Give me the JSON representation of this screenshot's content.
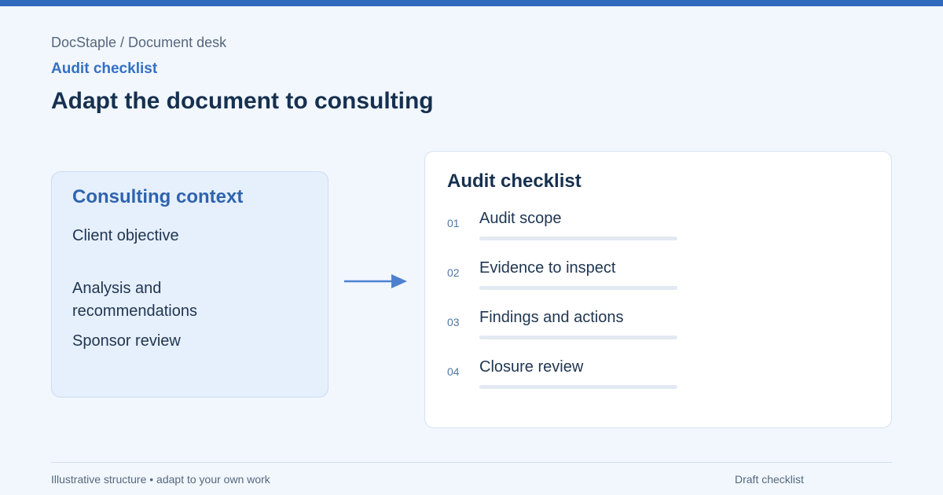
{
  "colors": {
    "accent": "#2f6abd",
    "kicker": "#3370c4",
    "background": "#f2f7fe",
    "context_card": "#e6effc",
    "text": "#16304f"
  },
  "header": {
    "breadcrumb": "DocStaple / Document desk",
    "kicker": "Audit checklist",
    "title": "Adapt the document to consulting"
  },
  "context": {
    "title": "Consulting context",
    "items": [
      "Client objective",
      "Analysis and recommendations",
      "Sponsor review"
    ]
  },
  "arrow_icon": "arrow-right-icon",
  "checklist": {
    "title": "Audit checklist",
    "steps": [
      {
        "num": "01",
        "label": "Audit scope"
      },
      {
        "num": "02",
        "label": "Evidence to inspect"
      },
      {
        "num": "03",
        "label": "Findings and actions"
      },
      {
        "num": "04",
        "label": "Closure review"
      }
    ]
  },
  "footer": {
    "left": "Illustrative structure • adapt to your own work",
    "right": "Draft checklist"
  }
}
